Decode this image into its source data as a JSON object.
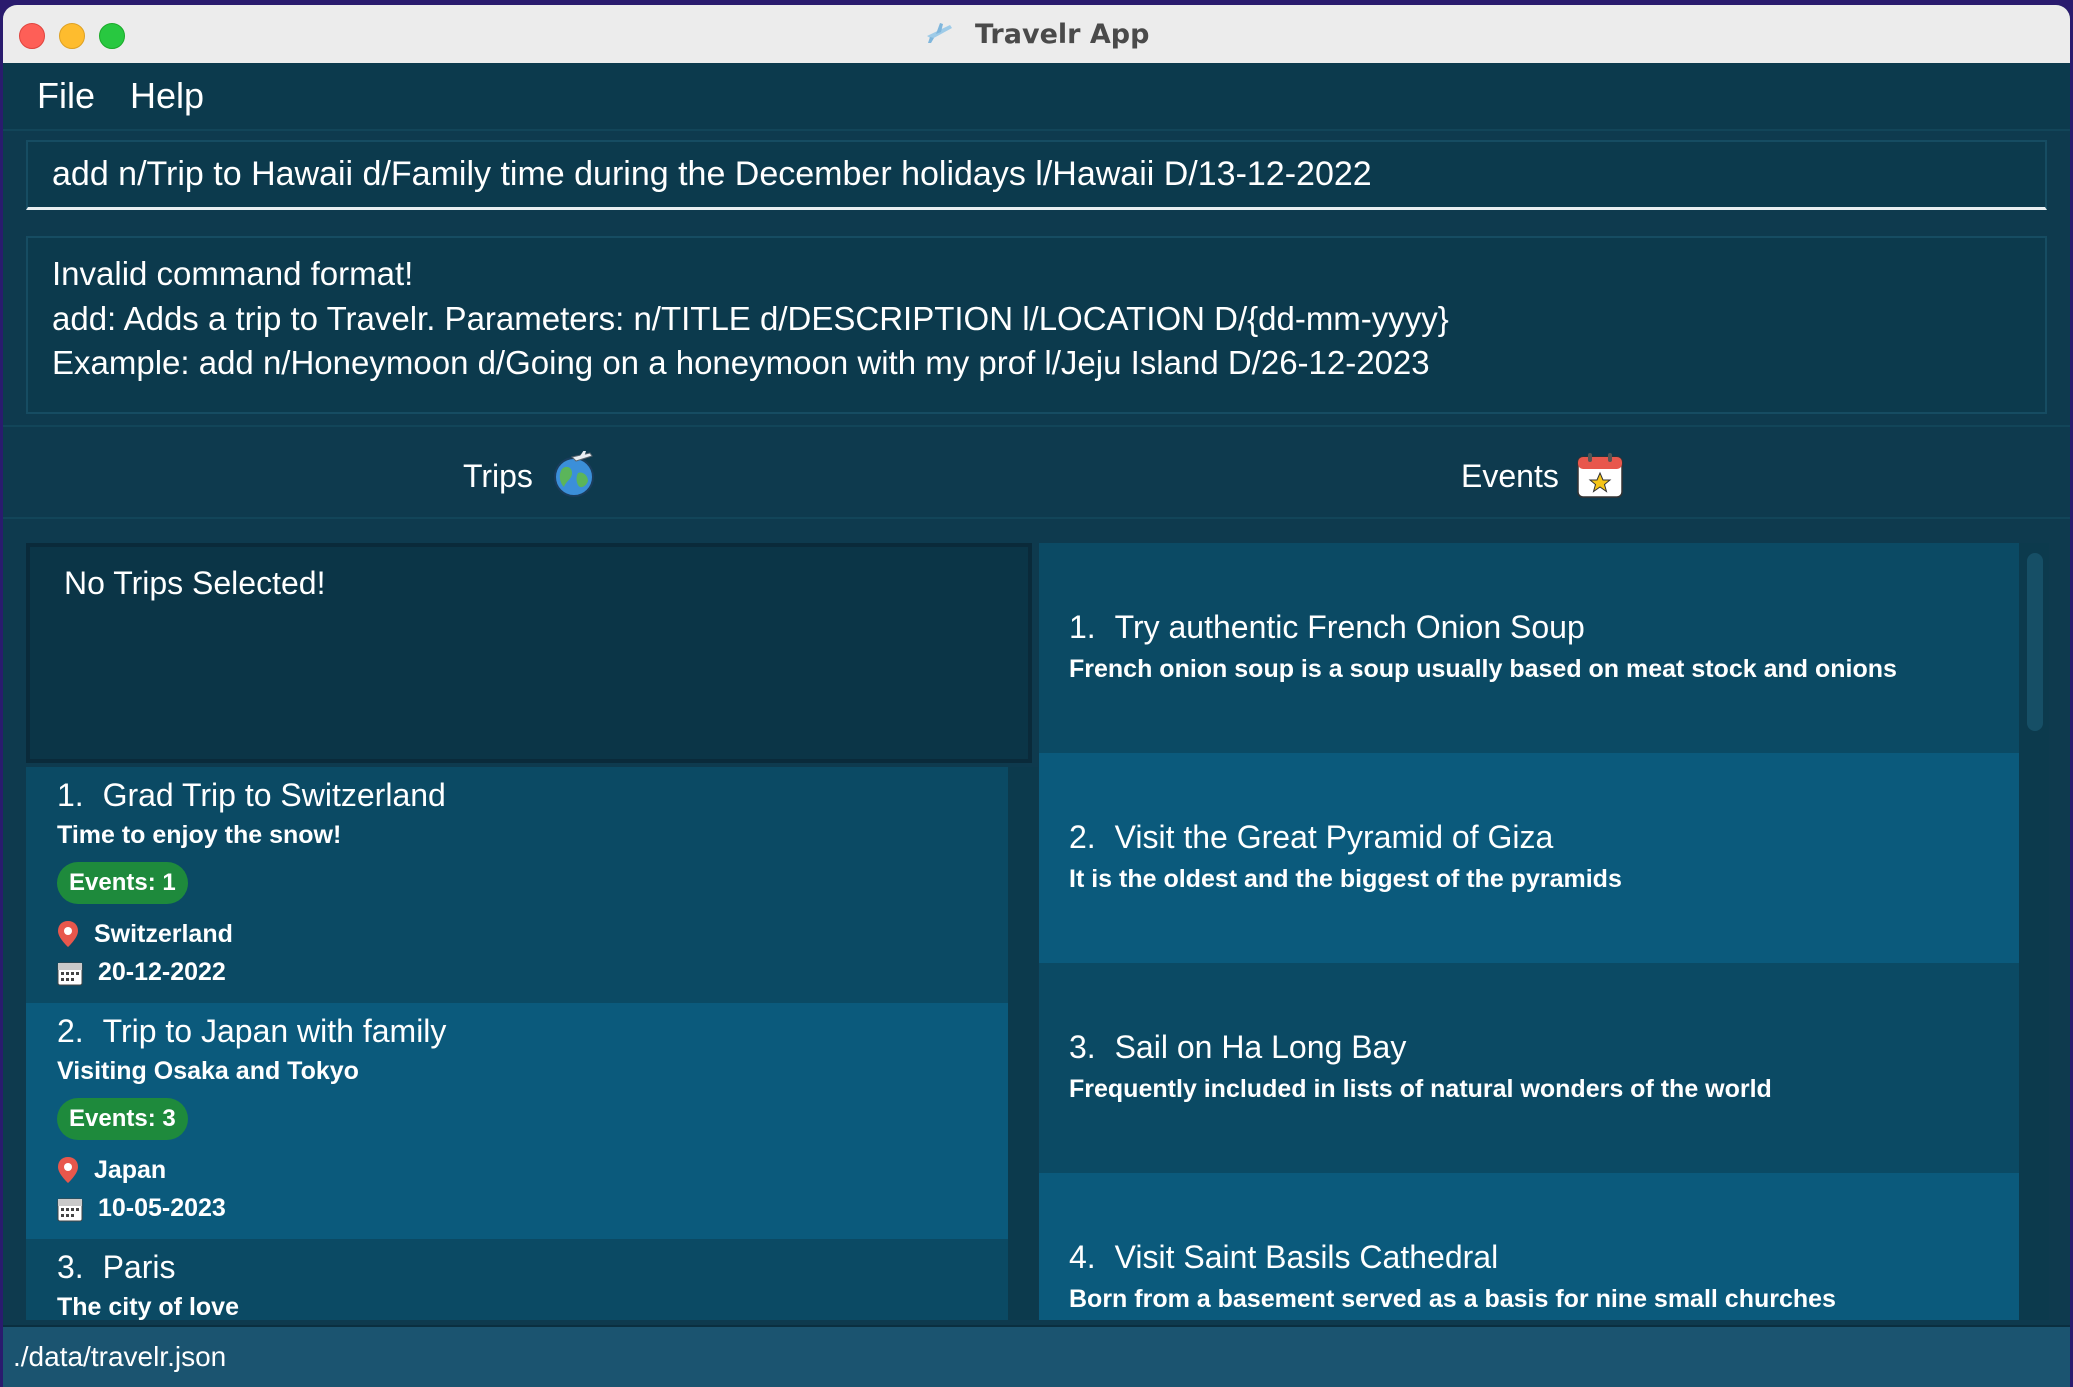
{
  "window": {
    "title": "Travelr App"
  },
  "menu": {
    "file": "File",
    "help": "Help"
  },
  "command": {
    "value": "add n/Trip to Hawaii d/Family time during the December holidays l/Hawaii D/13-12-2022"
  },
  "result": {
    "line1": "Invalid command format!",
    "line2": "add: Adds a trip to Travelr. Parameters: n/TITLE d/DESCRIPTION l/LOCATION D/{dd-mm-yyyy}",
    "line3": "Example: add n/Honeymoon d/Going on a honeymoon with my prof l/Jeju Island D/26-12-2023"
  },
  "headers": {
    "trips": "Trips",
    "events": "Events"
  },
  "selected_trip": {
    "text": "No Trips Selected!"
  },
  "trips": [
    {
      "index": "1.",
      "title": "Grad Trip to Switzerland",
      "description": "Time to enjoy the snow!",
      "badge": "Events: 1",
      "location": "Switzerland",
      "date": "20-12-2022"
    },
    {
      "index": "2.",
      "title": "Trip to Japan with family",
      "description": "Visiting Osaka and Tokyo",
      "badge": "Events: 3",
      "location": "Japan",
      "date": "10-05-2023"
    },
    {
      "index": "3.",
      "title": "Paris",
      "description": "The city of love"
    }
  ],
  "events": [
    {
      "index": "1.",
      "title": "Try authentic French Onion Soup",
      "description": "French onion soup is a soup usually based on meat stock and onions"
    },
    {
      "index": "2.",
      "title": "Visit the Great Pyramid of Giza",
      "description": "It is the oldest and the biggest of the pyramids"
    },
    {
      "index": "3.",
      "title": "Sail on Ha Long Bay",
      "description": "Frequently included in lists of natural wonders of the world"
    },
    {
      "index": "4.",
      "title": "Visit Saint Basils Cathedral",
      "description": "Born from a basement served as a basis for nine small churches"
    }
  ],
  "status": {
    "path": "./data/travelr.json"
  },
  "colors": {
    "window_bg": "#0e3a4e",
    "card_dark": "#0b4a64",
    "card_light": "#0b5a7c",
    "badge_green": "#1e8a3c",
    "status_bar": "#1b5470"
  },
  "icons": {
    "app": "airplane-icon",
    "trips": "globe-airplane-icon",
    "events": "calendar-star-icon",
    "location": "location-pin-icon",
    "date": "calendar-icon"
  }
}
